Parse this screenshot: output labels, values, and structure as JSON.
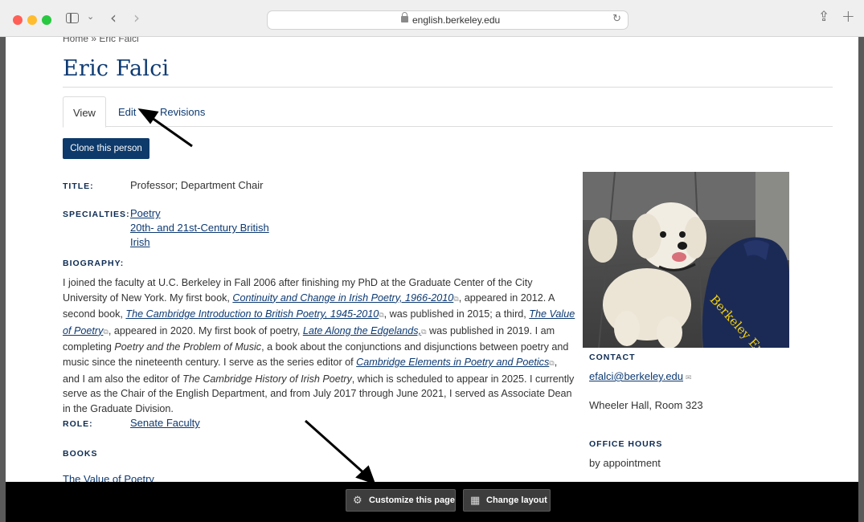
{
  "browser": {
    "url": "english.berkeley.edu"
  },
  "breadcrumb": "Home  »  Eric Falci",
  "page_title": "Eric Falci",
  "tabs": [
    {
      "label": "View"
    },
    {
      "label": "Edit"
    },
    {
      "label": "Revisions"
    }
  ],
  "clone_button": "Clone this person",
  "fields": {
    "title_label": "TITLE:",
    "title_value": "Professor; Department Chair",
    "specialties_label": "SPECIALTIES:",
    "specialties": [
      "Poetry",
      "20th- and 21st-Century British",
      "Irish"
    ],
    "biography_label": "BIOGRAPHY:",
    "role_label": "ROLE:",
    "role_value": "Senate Faculty",
    "books_label": "BOOKS",
    "book_1": "The Value of Poetry"
  },
  "biography": {
    "p1": "I joined the faculty at U.C. Berkeley in Fall 2006 after finishing my PhD at the Graduate Center of the City University of New York. My first book, ",
    "l1": "Continuity and Change in Irish Poetry, 1966-2010",
    "p2": ", appeared in 2012. A second book, ",
    "l2": "The Cambridge Introduction to British Poetry, 1945-2010",
    "p3": ", was published in 2015; a third, ",
    "l3": "The Value of Poetry",
    "p4": ", appeared in 2020. My first book of poetry, ",
    "l4": "Late Along the Edgelands,",
    "p5": " was published in 2019. I am completing ",
    "i1": "Poetry and the Problem of Music",
    "p6": ", a book about the conjunctions and disjunctions between poetry and music since the nineteenth century. I serve as the series editor of ",
    "l5": "Cambridge Elements in Poetry and Poetics",
    "p7": ", and I am also the editor of ",
    "i2": "The Cambridge History of Irish Poetry",
    "p8": ", which is scheduled to appear in 2025. I currently serve as the Chair of the English Department, and from July 2017 through June 2021, I served as Associate Dean in the Graduate Division."
  },
  "photo": {
    "shirt_text": "Berkeley English"
  },
  "contact": {
    "label": "CONTACT",
    "email": "efalci@berkeley.edu",
    "location": "Wheeler Hall, Room 323",
    "office_hours_label": "OFFICE HOURS",
    "office_hours": "by appointment"
  },
  "bottom_bar": {
    "customize": "Customize this page",
    "change_layout": "Change layout"
  },
  "colors": {
    "brand_navy": "#0d3a72",
    "button_navy": "#0d3a6b"
  }
}
